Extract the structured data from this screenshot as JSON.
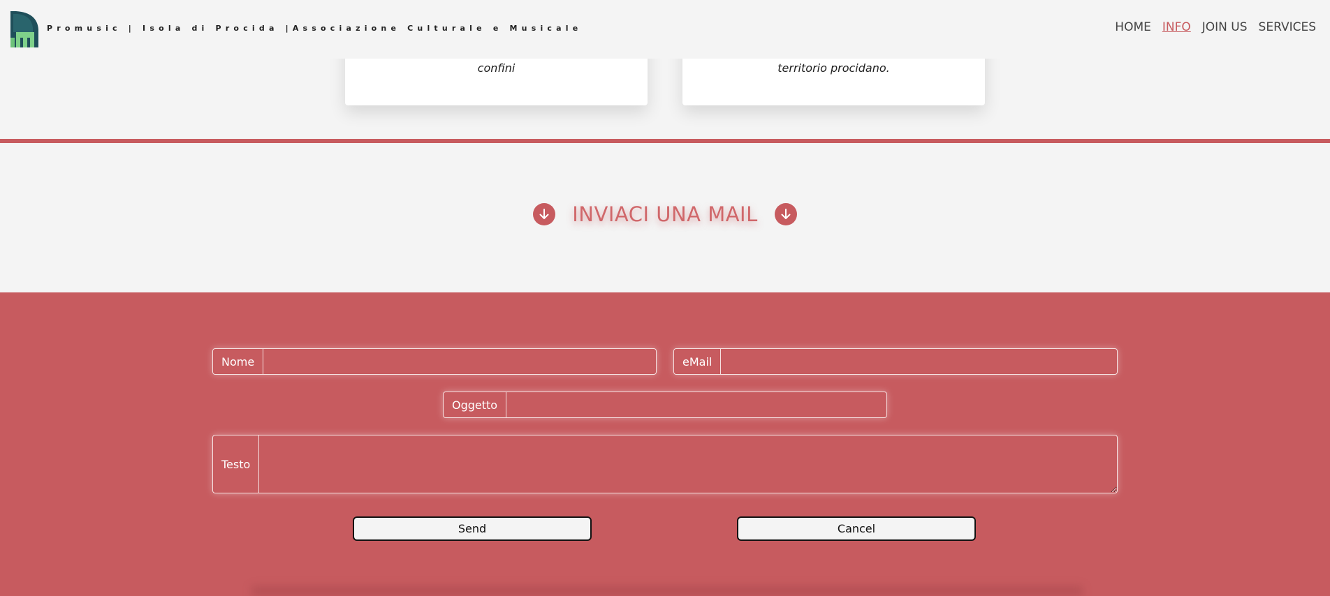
{
  "header": {
    "site_title": "Promusic | Isola di Procida |Associazione Culturale e Musicale",
    "logo_icon": "promusic-logo-icon",
    "nav": [
      {
        "label": "HOME",
        "active": false
      },
      {
        "label": "INFO",
        "active": true
      },
      {
        "label": "JOIN US",
        "active": false
      },
      {
        "label": "SERVICES",
        "active": false
      }
    ]
  },
  "cards": {
    "card1_text": "confini",
    "card2_text": "territorio procidano."
  },
  "section": {
    "heading": "INVIACI UNA MAIL",
    "arrow_icon": "arrow-down-icon"
  },
  "form": {
    "nome_label": "Nome",
    "nome_value": "",
    "email_label": "eMail",
    "email_value": "",
    "oggetto_label": "Oggetto",
    "oggetto_value": "",
    "testo_label": "Testo",
    "testo_value": "",
    "send_label": "Send",
    "cancel_label": "Cancel"
  },
  "colors": {
    "accent": "#c75b5f",
    "background": "#f4f4f4",
    "heading": "#d0676a"
  }
}
